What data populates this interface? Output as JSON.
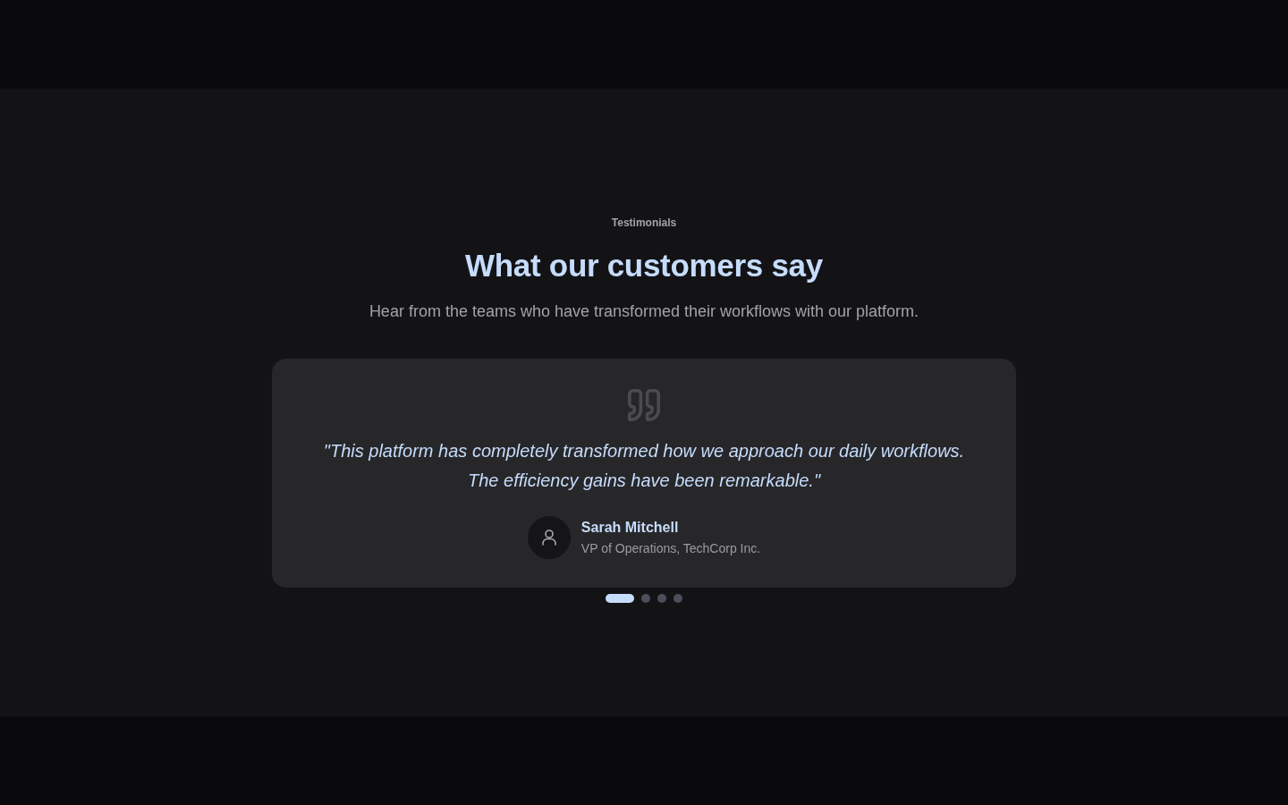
{
  "section": {
    "eyebrow": "Testimonials",
    "title": "What our customers say",
    "subtitle": "Hear from the teams who have transformed their workflows with our platform."
  },
  "testimonial": {
    "quote": "\"This platform has completely transformed how we approach our daily workflows. The efficiency gains have been remarkable.\"",
    "author": {
      "name": "Sarah Mitchell",
      "role": "VP of Operations, TechCorp Inc."
    }
  },
  "pagination": [
    {
      "selected": true
    },
    {
      "selected": false
    },
    {
      "selected": false
    },
    {
      "selected": false
    }
  ]
}
